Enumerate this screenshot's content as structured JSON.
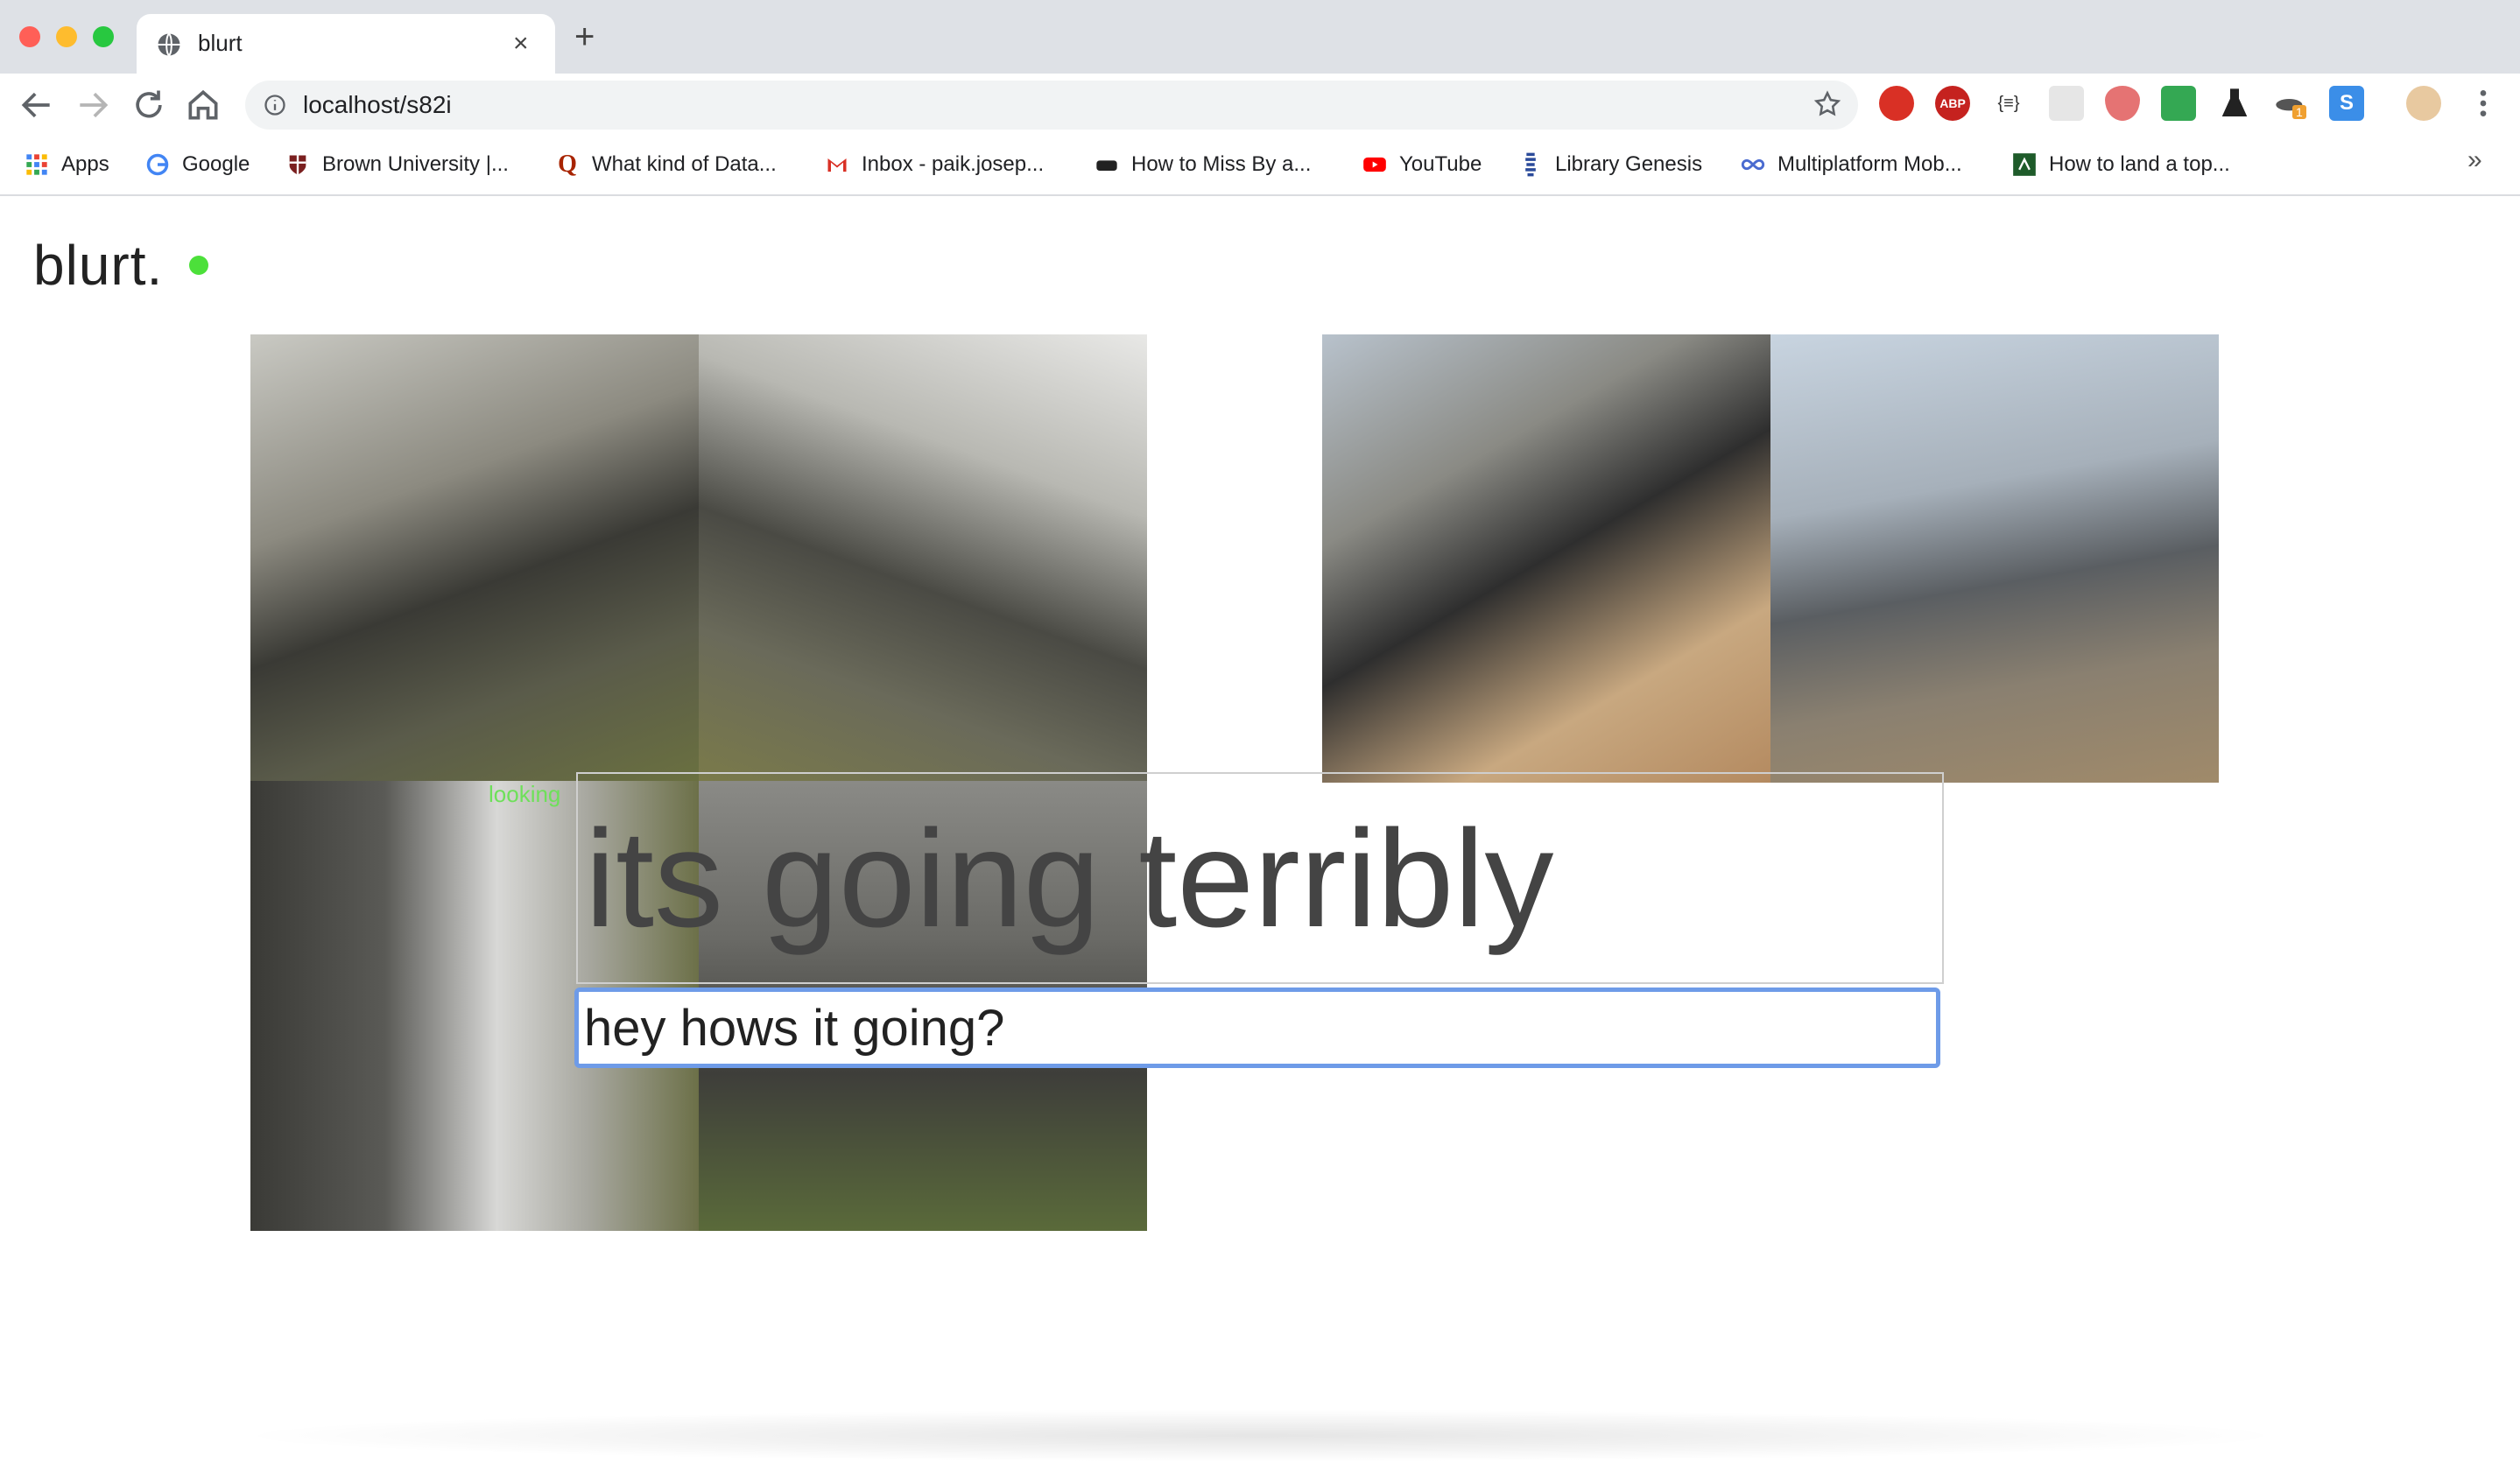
{
  "browser": {
    "tab_title": "blurt",
    "url": "localhost/s82i",
    "bookmarks": [
      {
        "label": "Apps",
        "icon": "apps-grid-icon"
      },
      {
        "label": "Google",
        "icon": "google-icon"
      },
      {
        "label": "Brown University |...",
        "icon": "brown-university-icon"
      },
      {
        "label": "What kind of Data...",
        "icon": "quora-icon"
      },
      {
        "label": "Inbox - paik.josep...",
        "icon": "gmail-icon"
      },
      {
        "label": "How to Miss By a...",
        "icon": "site-icon"
      },
      {
        "label": "YouTube",
        "icon": "youtube-icon"
      },
      {
        "label": "Library Genesis",
        "icon": "library-icon"
      },
      {
        "label": "Multiplatform Mob...",
        "icon": "infinity-icon"
      },
      {
        "label": "How to land a top...",
        "icon": "site-icon"
      }
    ],
    "extensions_badge": "1"
  },
  "app": {
    "brand": "blurt.",
    "status_color": "#4ce03a",
    "status_text": "looking",
    "output_text": "its going terribly",
    "input_value": "hey hows it going?"
  }
}
